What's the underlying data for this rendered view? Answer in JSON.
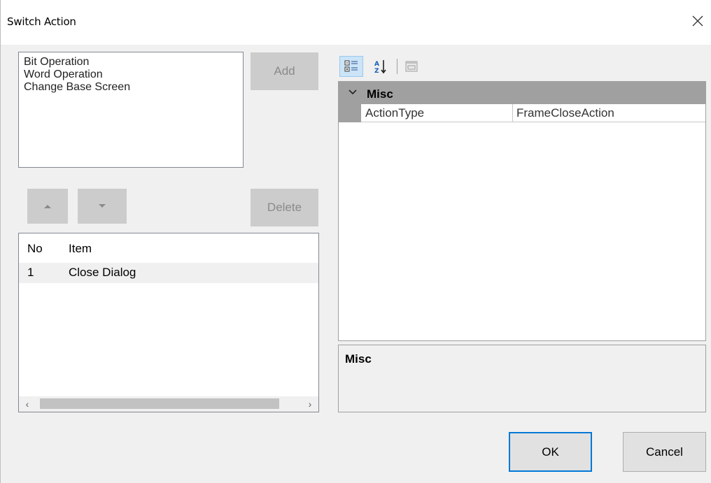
{
  "dialog": {
    "title": "Switch Action"
  },
  "action_list": {
    "items": [
      "Bit Operation",
      "Word Operation",
      "Change Base Screen"
    ]
  },
  "buttons": {
    "add": "Add",
    "delete": "Delete",
    "ok": "OK",
    "cancel": "Cancel"
  },
  "item_list": {
    "columns": [
      "No",
      "Item"
    ],
    "rows": [
      {
        "no": "1",
        "item": "Close Dialog"
      }
    ]
  },
  "property_grid": {
    "category": "Misc",
    "properties": [
      {
        "name": "ActionType",
        "value": "FrameCloseAction"
      }
    ],
    "help_title": "Misc"
  },
  "icons": [
    "close-icon",
    "move-up-icon",
    "move-down-icon",
    "categorized-icon",
    "alphabetical-sort-icon",
    "property-pages-icon",
    "chevron-down-icon",
    "scroll-left-icon",
    "scroll-right-icon"
  ]
}
